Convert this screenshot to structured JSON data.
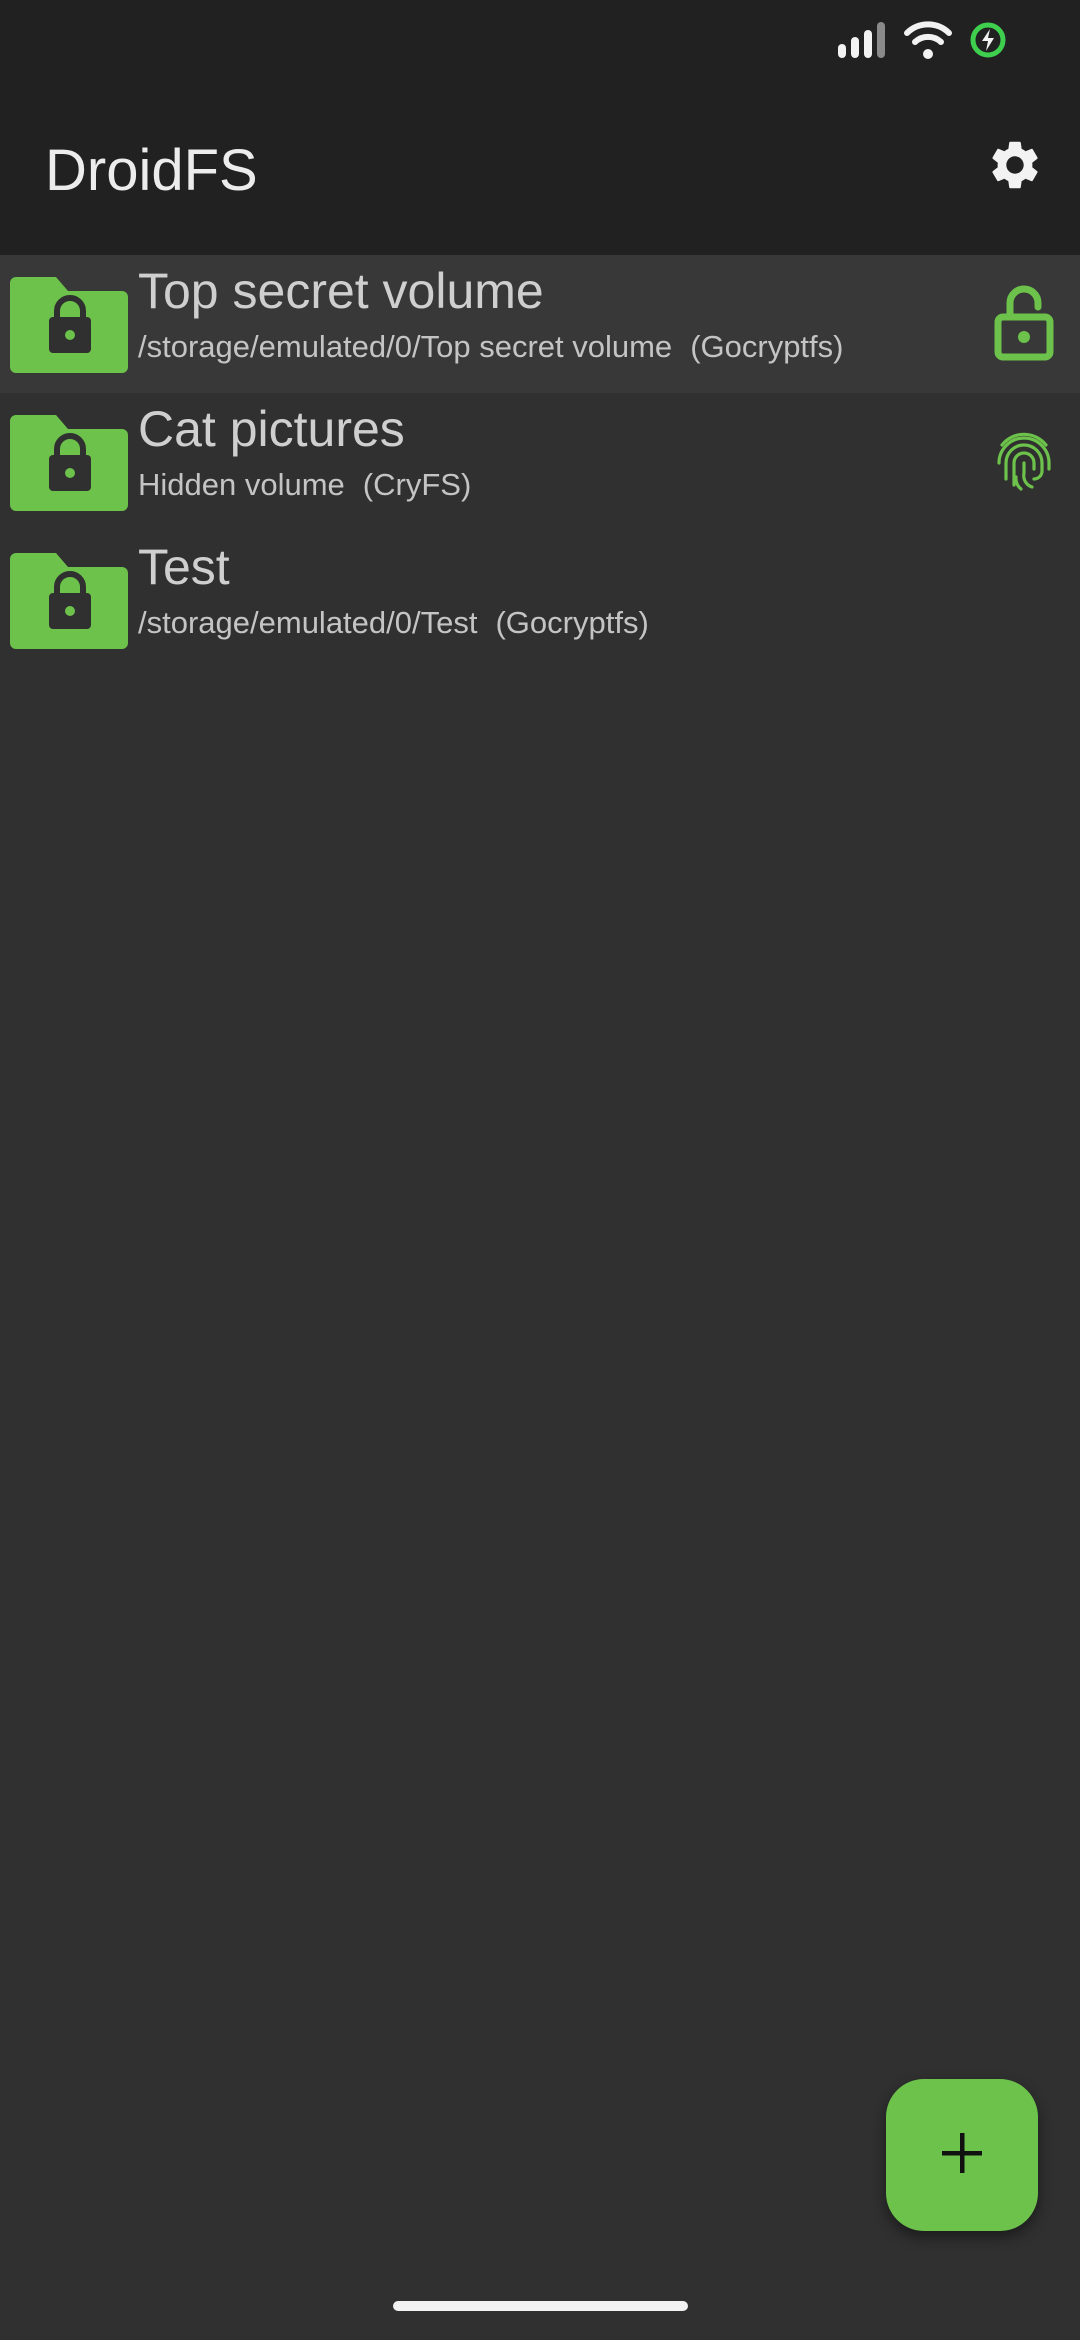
{
  "status_bar": {
    "icons": [
      "signal-icon",
      "wifi-icon",
      "battery-charging-icon"
    ],
    "battery_ring_color": "#3ecf4e"
  },
  "app_bar": {
    "title": "DroidFS",
    "settings_icon": "gear-icon"
  },
  "accent_color": "#6cc24a",
  "volumes": [
    {
      "name": "Top secret volume",
      "path": "/storage/emulated/0/Top secret volume",
      "type": "(Gocryptfs)",
      "selected": true,
      "trailing_icon": "unlocked-padlock-icon"
    },
    {
      "name": "Cat pictures",
      "path": "Hidden volume",
      "type": "(CryFS)",
      "selected": false,
      "trailing_icon": "fingerprint-icon"
    },
    {
      "name": "Test",
      "path": "/storage/emulated/0/Test",
      "type": "(Gocryptfs)",
      "selected": false,
      "trailing_icon": ""
    }
  ],
  "fab": {
    "icon": "plus-icon"
  }
}
